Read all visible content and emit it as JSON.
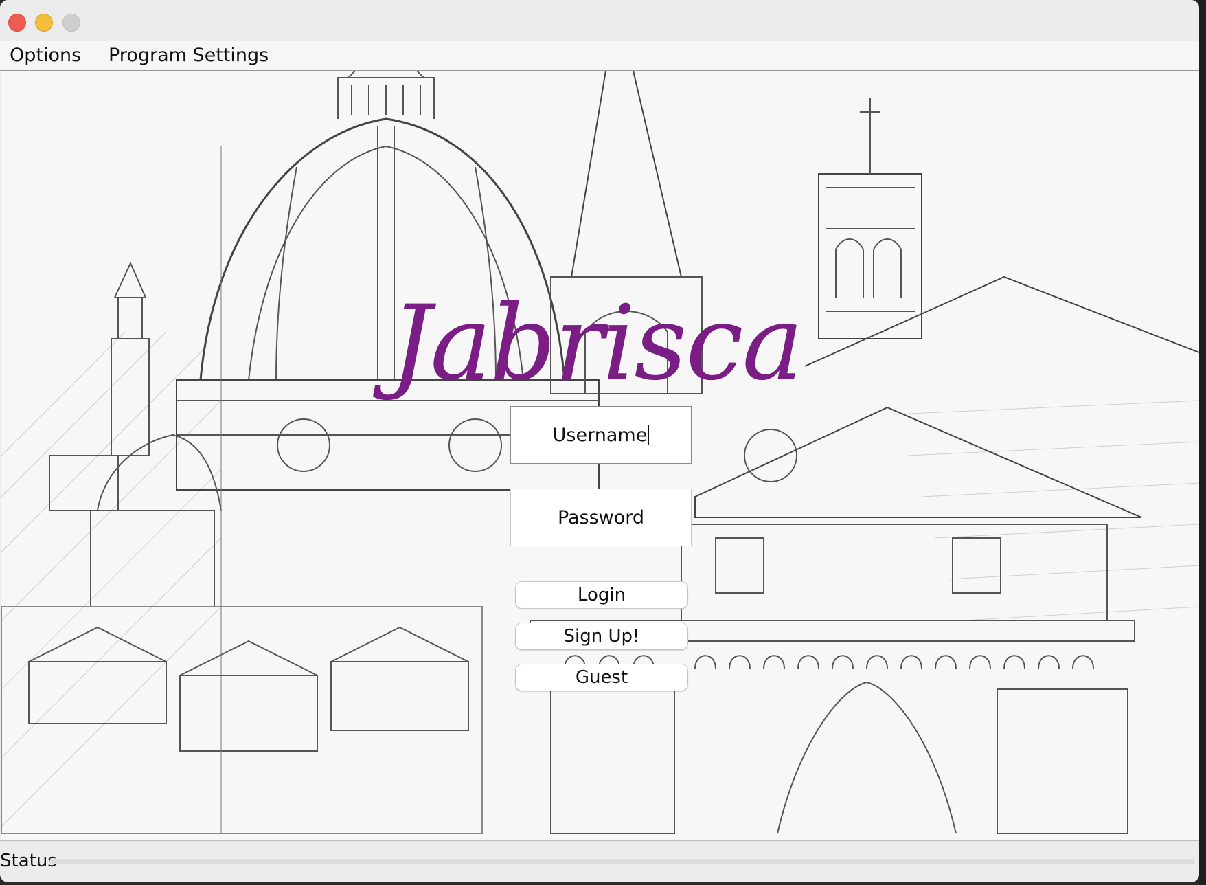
{
  "window": {
    "controls": [
      "close-icon",
      "minimize-icon",
      "zoom-icon"
    ]
  },
  "menu": {
    "items": [
      {
        "label": "Options"
      },
      {
        "label": "Program Settings"
      }
    ]
  },
  "login": {
    "brand": "Jabrisca",
    "brand_color": "#7a1e86",
    "username_value": "Username",
    "password_value": "Password",
    "login_label": "Login",
    "signup_label": "Sign Up!",
    "guest_label": "Guest"
  },
  "status": {
    "label": "Status"
  },
  "background": {
    "image": "pencil-sketch-cathedral"
  }
}
